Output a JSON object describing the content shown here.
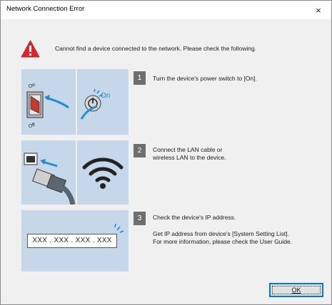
{
  "window": {
    "title": "Network Connection Error",
    "close_glyph": "×"
  },
  "message": "Cannot find a device connected to the network. Please check the following.",
  "steps": [
    {
      "number": "1",
      "lines": [
        "Turn the device's power switch to [On]."
      ],
      "panel_labels": {
        "on": "On",
        "off": "Off",
        "on_badge": "On"
      }
    },
    {
      "number": "2",
      "lines": [
        "Connect the LAN cable or",
        "wireless LAN to the device."
      ]
    },
    {
      "number": "3",
      "lines": [
        "Check the device's IP address."
      ],
      "detail_lines": [
        "Get IP address from device's [System Setting List].",
        "For more information, please check the User Guide."
      ],
      "ip_placeholder": "XXX . XXX . XXX . XXX"
    }
  ],
  "buttons": {
    "ok": "OK"
  },
  "colors": {
    "panel_bg": "#c5d7e9",
    "badge_bg": "#6e6e6e",
    "warning_red": "#d9262c",
    "accent_blue": "#1f8fd0",
    "focus_blue": "#0078d7"
  },
  "icons": [
    "warning-icon",
    "power-switch-icon",
    "power-button-icon",
    "lan-cable-icon",
    "wifi-icon",
    "close-icon"
  ]
}
